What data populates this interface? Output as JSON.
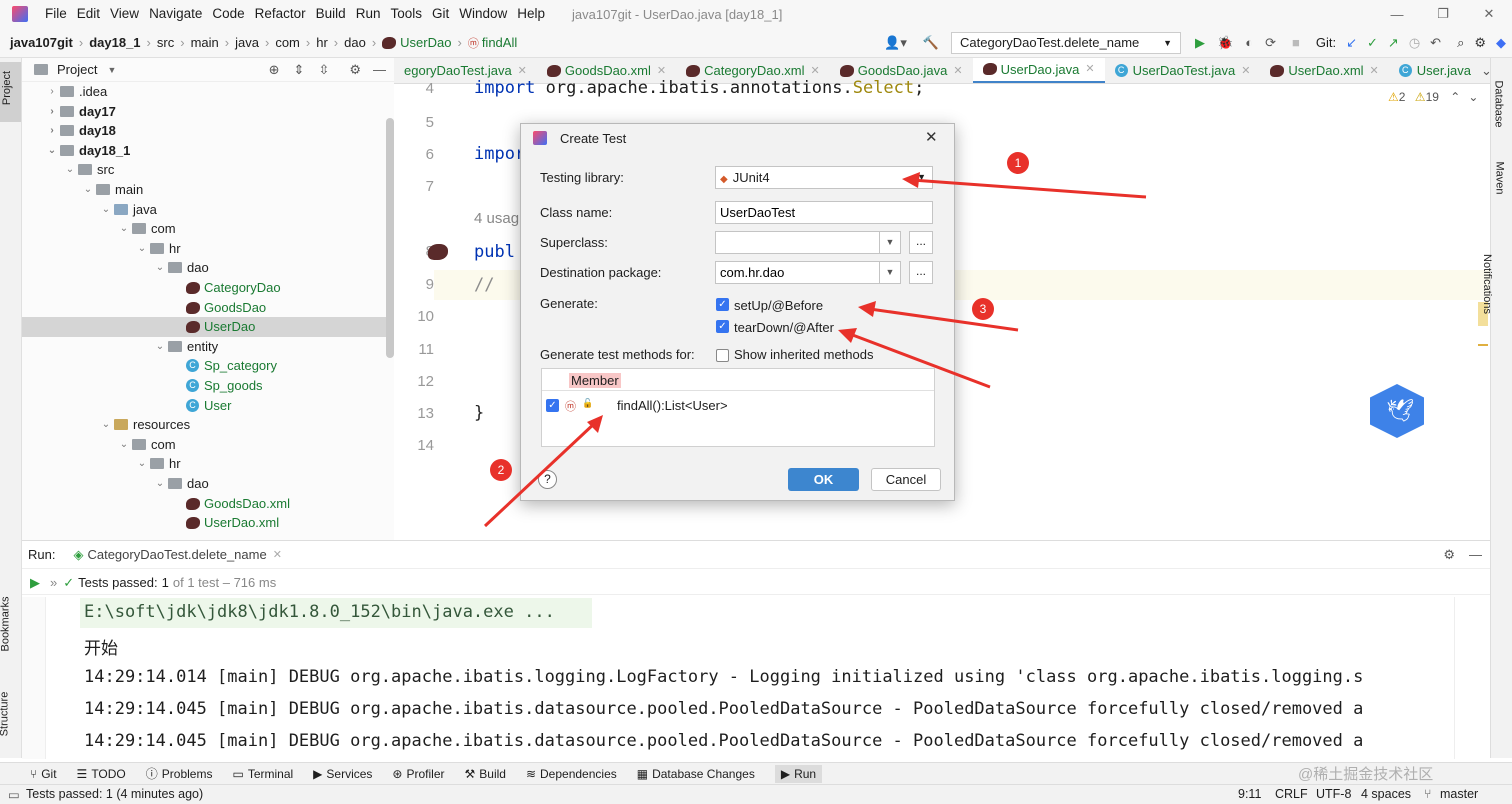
{
  "menu": {
    "items": [
      "File",
      "Edit",
      "View",
      "Navigate",
      "Code",
      "Refactor",
      "Build",
      "Run",
      "Tools",
      "Git",
      "Window",
      "Help"
    ],
    "title": "java107git - UserDao.java [day18_1]"
  },
  "nav": {
    "crumbs": [
      "java107git",
      "day18_1",
      "src",
      "main",
      "java",
      "com",
      "hr",
      "dao",
      "UserDao",
      "findAll"
    ],
    "run_config": "CategoryDaoTest.delete_name",
    "git_label": "Git:"
  },
  "project": {
    "title": "Project",
    "tree": [
      ".idea",
      "day17",
      "day18",
      "day18_1",
      "src",
      "main",
      "java",
      "com",
      "hr",
      "dao",
      "CategoryDao",
      "GoodsDao",
      "UserDao",
      "entity",
      "Sp_category",
      "Sp_goods",
      "User",
      "resources",
      "com",
      "hr",
      "dao",
      "GoodsDao.xml",
      "UserDao.xml"
    ]
  },
  "tabs": [
    "egoryDaoTest.java",
    "GoodsDao.xml",
    "CategoryDao.xml",
    "GoodsDao.java",
    "UserDao.java",
    "UserDaoTest.java",
    "UserDao.xml",
    "User.java"
  ],
  "editor": {
    "line_numbers": [
      "4",
      "5",
      "6",
      "7",
      "",
      "8",
      "9",
      "10",
      "11",
      "12",
      "13",
      "14"
    ],
    "code_import": "import",
    "code_import_rest": "org.apache.ibatis.annotations.",
    "code_select": "Select",
    "code_semicolon": ";",
    "code_impor": "impor",
    "code_usages": "4 usag",
    "code_publ": "publ",
    "code_comment": "//",
    "code_brace": "}",
    "warnings": "2",
    "weak_warnings": "19"
  },
  "right_tools": [
    "Database",
    "Maven",
    "Notifications"
  ],
  "left_tools": [
    "Project",
    "Bookmarks",
    "Structure"
  ],
  "dialog": {
    "title": "Create Test",
    "testing_library_label": "Testing library:",
    "testing_library_value": "JUnit4",
    "class_name_label": "Class name:",
    "class_name_value": "UserDaoTest",
    "superclass_label": "Superclass:",
    "superclass_value": "",
    "dest_package_label": "Destination package:",
    "dest_package_value": "com.hr.dao",
    "browse": "...",
    "generate_label": "Generate:",
    "setup_label": "setUp/@Before",
    "teardown_label": "tearDown/@After",
    "gen_methods_label": "Generate test methods for:",
    "inherited_label": "Show inherited methods",
    "member_header": "Member",
    "member_row": "findAll():List<User>",
    "help": "?",
    "ok": "OK",
    "cancel": "Cancel"
  },
  "annotations": {
    "n1": "1",
    "n2": "2",
    "n3": "3"
  },
  "run": {
    "label": "Run:",
    "tab": "CategoryDaoTest.delete_name",
    "tests_passed": "Tests passed:",
    "tests_count": "1",
    "tests_detail": "of 1 test – 716 ms",
    "lines": [
      "E:\\soft\\jdk\\jdk8\\jdk1.8.0_152\\bin\\java.exe ...",
      "开始",
      "14:29:14.014 [main] DEBUG org.apache.ibatis.logging.LogFactory - Logging initialized using 'class org.apache.ibatis.logging.s",
      "14:29:14.045 [main] DEBUG org.apache.ibatis.datasource.pooled.PooledDataSource - PooledDataSource forcefully closed/removed a",
      "14:29:14.045 [main] DEBUG org.apache.ibatis.datasource.pooled.PooledDataSource - PooledDataSource forcefully closed/removed a"
    ]
  },
  "bottom_tools": [
    "Git",
    "TODO",
    "Problems",
    "Terminal",
    "Services",
    "Profiler",
    "Build",
    "Dependencies",
    "Database Changes",
    "Run"
  ],
  "status": {
    "message": "Tests passed: 1 (4 minutes ago)",
    "position": "9:11",
    "line_sep": "CRLF",
    "encoding": "UTF-8",
    "indent": "4 spaces",
    "branch": "master",
    "watermark": "@稀土掘金技术社区"
  },
  "colors": {
    "accent": "#3574f0",
    "arrow": "#e8312a",
    "ok_button": "#3d86cf"
  }
}
